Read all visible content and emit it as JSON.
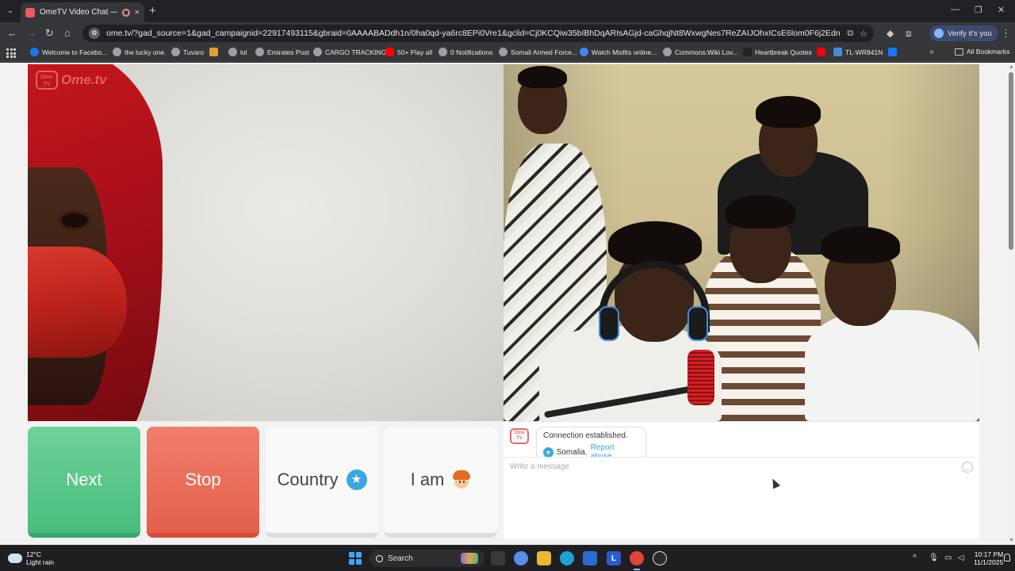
{
  "browser": {
    "tab": {
      "title": "OmeTV Video Chat — Ome",
      "close": "×"
    },
    "new_tab": "+",
    "window_controls": {
      "minimize": "—",
      "maximize": "❐",
      "close": "✕"
    },
    "nav": {
      "back": "←",
      "forward": "→",
      "reload": "↻",
      "home": "⌂"
    },
    "url": "ome.tv/?gad_source=1&gad_campaignid=22917493115&gbraid=0AAAABADdh1n/0ha0qd-ya6rc8EPi0Vre1&gclid=Cj0KCQiw35bIBhDqARIsAGjd-caGhqjNt8WxwgNes7ReZAIJOhxICsE6lom0F6j2Ednyg4u6T6woRhEaAqcVEALw...",
    "verify_label": "Verify it's you",
    "bookmarks": [
      {
        "label": "Welcome to Facebo...",
        "color": "#1877f2"
      },
      {
        "label": "the lucky one.",
        "color": "#9aa0a6"
      },
      {
        "label": "Tuvaro",
        "color": "#9aa0a6"
      },
      {
        "label": "",
        "color": "#e0a030"
      },
      {
        "label": "lol",
        "color": "#9aa0a6"
      },
      {
        "label": "Emirates Post",
        "color": "#9aa0a6"
      },
      {
        "label": "CARGO TRACKING",
        "color": "#9aa0a6"
      },
      {
        "label": "50+ Play all",
        "color": "#ff0000"
      },
      {
        "label": "0 Notifications",
        "color": "#9aa0a6"
      },
      {
        "label": "Somali Armed Force...",
        "color": "#9aa0a6"
      },
      {
        "label": "Watch Misfits online...",
        "color": "#4285f4"
      },
      {
        "label": "Commons:Wiki Lov...",
        "color": "#9aa0a6"
      },
      {
        "label": "Heartbreak Quotes",
        "color": "#222222"
      },
      {
        "label": "",
        "color": "#ff0000"
      },
      {
        "label": "TL-WR841N",
        "color": "#4a8ad8"
      },
      {
        "label": "",
        "color": "#1877f2"
      }
    ],
    "bookmarks_more": "»",
    "all_bookmarks": "All Bookmarks"
  },
  "site": {
    "logo_badge": "Ome TV",
    "logo_text": "Ome.tv",
    "buttons": {
      "next": "Next",
      "stop": "Stop",
      "country": "Country",
      "country_icon": "★",
      "i_am": "I am"
    },
    "chat": {
      "logo_badge": "Ome TV",
      "system_message": "Connection established.",
      "country_icon": "★",
      "partner_country": "Somalia.",
      "report_link": "Report abuse.",
      "input_placeholder": "Write a message"
    },
    "colors": {
      "next": "#49bd7b",
      "stop": "#e4604b",
      "accent_blue": "#3aa8de",
      "brand_red": "#e46b6b"
    }
  },
  "taskbar": {
    "weather_temp": "12°C",
    "weather_desc": "Light rain",
    "search_label": "Search",
    "apps": [
      {
        "name": "task-view",
        "label": "",
        "color": "#3a3a3e"
      },
      {
        "name": "copilot",
        "label": "",
        "color": "#5a8de6"
      },
      {
        "name": "file-explorer",
        "label": "",
        "color": "#e8b930"
      },
      {
        "name": "edge",
        "label": "",
        "color": "#1fa0d6"
      },
      {
        "name": "store",
        "label": "",
        "color": "#2d6bd4"
      },
      {
        "name": "launcher-l",
        "label": "L",
        "color": "#2a5bd7"
      },
      {
        "name": "chrome",
        "label": "",
        "color": "#e0443a"
      },
      {
        "name": "chatgpt",
        "label": "",
        "color": "#2a2a2a"
      }
    ],
    "tray_chevron": "^",
    "time": "10:17 PM",
    "date": "11/1/2025"
  }
}
